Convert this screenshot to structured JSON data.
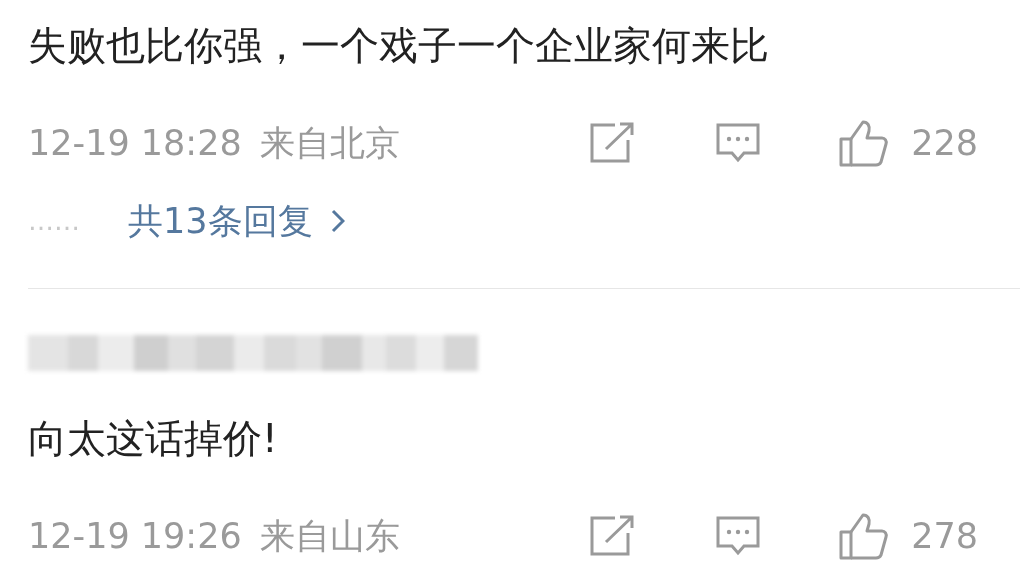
{
  "comments": [
    {
      "text": "失败也比你强，一个戏子一个企业家何来比",
      "time": "12-19 18:28",
      "location": "来自北京",
      "likes": "228",
      "replies": {
        "dots": "……",
        "label": "共13条回复"
      }
    },
    {
      "author": {
        "kind": "redacted"
      },
      "text": "向太这话掉价!",
      "time": "12-19 19:26",
      "location": "来自山东",
      "likes": "278"
    }
  ]
}
